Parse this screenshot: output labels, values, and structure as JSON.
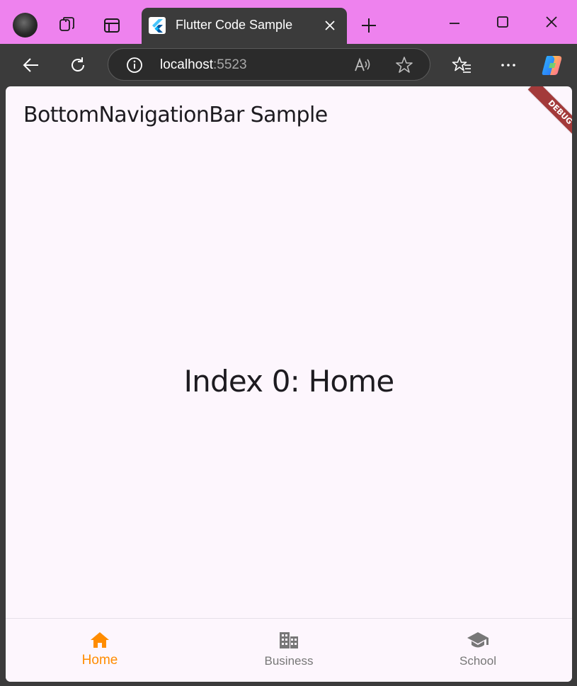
{
  "browser": {
    "tab_title": "Flutter Code Sample",
    "url_host": "localhost",
    "url_port": ":5523"
  },
  "app": {
    "title": "BottomNavigationBar Sample",
    "body_text": "Index 0: Home",
    "debug_banner": "DEBUG"
  },
  "bottom_nav": {
    "items": [
      {
        "label": "Home",
        "icon": "home-icon",
        "active": true
      },
      {
        "label": "Business",
        "icon": "business-icon",
        "active": false
      },
      {
        "label": "School",
        "icon": "school-icon",
        "active": false
      }
    ],
    "active_color": "#ff8c00",
    "inactive_color": "#777777"
  },
  "colors": {
    "titlebar": "#ee82ee",
    "browser_chrome": "#3b3b3b",
    "app_background": "#fdf6fd"
  }
}
